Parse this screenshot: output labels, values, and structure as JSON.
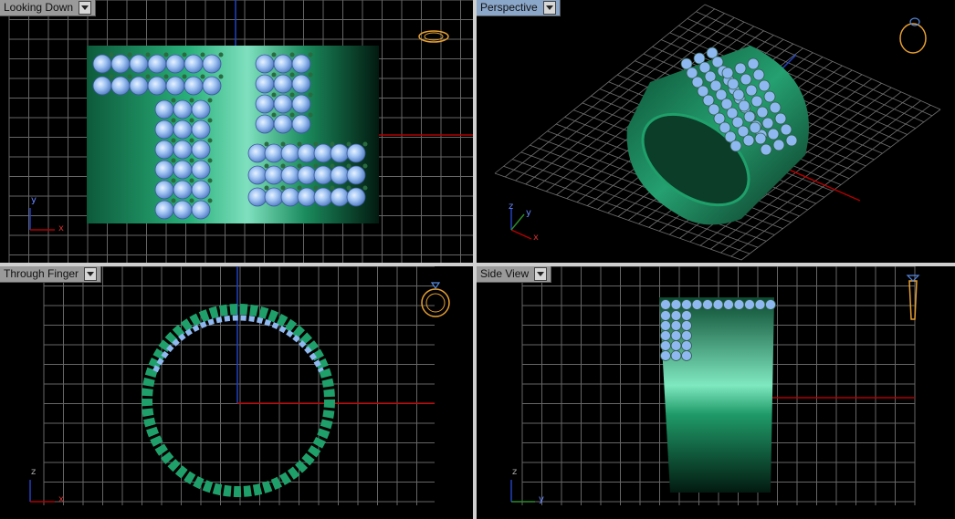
{
  "viewports": [
    {
      "id": "top",
      "label": "Looking Down",
      "active": false,
      "axes": [
        "y",
        "x"
      ]
    },
    {
      "id": "persp",
      "label": "Perspective",
      "active": true,
      "axes": [
        "z",
        "y",
        "x"
      ]
    },
    {
      "id": "front",
      "label": "Through Finger",
      "active": false,
      "axes": [
        "z",
        "x"
      ]
    },
    {
      "id": "side",
      "label": "Side View",
      "active": false,
      "axes": [
        "z",
        "y"
      ]
    }
  ],
  "colors": {
    "background": "#000000",
    "grid": "#6e6e6e",
    "axis_red": "#b00000",
    "axis_blue": "#2040c0",
    "metal": "#1fa06a",
    "gem": "#8fb8f0",
    "gizmo": "#e8a030",
    "active_tab": "#8aa6c8",
    "tab": "#9a9a9a"
  },
  "icons": [
    "ring-gizmo-icon",
    "dropdown-arrow-icon"
  ]
}
